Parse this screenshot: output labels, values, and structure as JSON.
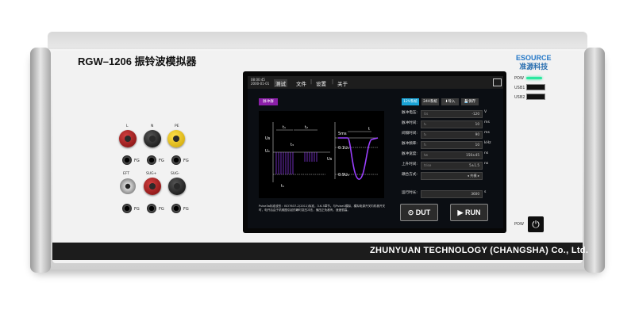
{
  "device": {
    "model_title": "RGW–1206  振铃波模拟器",
    "brand_name": "ESOURCE",
    "brand_cn": "准源科技",
    "footer": "ZHUNYUAN TECHNOLOGY (CHANGSHA) Co., Ltd.",
    "indicators": {
      "pow": "POW",
      "usb1": "USB1",
      "usb2": "USB2"
    },
    "power_button_label": "POW",
    "power_led_color": "#2be8a0"
  },
  "terminals": {
    "top_labels": [
      "L",
      "N",
      "PE"
    ],
    "bottom_labels": [
      "EFT",
      "SUG+",
      "SUG-"
    ],
    "fg": "FG"
  },
  "screen": {
    "clock_time": "08:00:45",
    "clock_date": "2000-01-01",
    "tabs": [
      "测试",
      "文件",
      "设置",
      "关于"
    ],
    "active_tab": "测试",
    "pulse_button": "脉冲群",
    "mode_buttons": [
      "12V系统",
      "24V系统",
      "⬇导入",
      "💾保存"
    ],
    "mode_active_color": "#1aa3d6",
    "params": [
      {
        "label": "脉冲电压:",
        "ph": "Us",
        "value": "-120",
        "unit": "V"
      },
      {
        "label": "脉冲时间:",
        "ph": "t₁",
        "value": "10",
        "unit": "ms"
      },
      {
        "label": "间隔时间:",
        "ph": "t₂",
        "value": "90",
        "unit": "ms"
      },
      {
        "label": "脉冲频率:",
        "ph": "f₁",
        "value": "10",
        "unit": "kHz"
      },
      {
        "label": "脉冲宽度:",
        "ph": "tw",
        "value": "150±45",
        "unit": "ns"
      },
      {
        "label": "上升时间:",
        "ph": "trise",
        "value": "5±1.5",
        "unit": "ns"
      },
      {
        "label": "耦合方式:",
        "ph": "",
        "value": "◂ 共模 ▸",
        "unit": ""
      },
      {
        "label": "运行时长:",
        "ph": "",
        "value": "3600",
        "unit": "s"
      }
    ],
    "description": "Pulse3a标准波形：ISO7637-2(2011)标准，3.6.3章节。与Pulse1模拟，模拟电源开关内机械开关时，电开后由于机械图引起的瞬时变压冲击，偏压正负都有，速度很高。",
    "waveform": {
      "labels": {
        "us": "Us",
        "u0": "U₀",
        "t1": "t₁",
        "t2": "t₂",
        "ts": "t₃",
        "t1b": "t₁",
        "tlong": "5ms",
        "u01": "0.1U₀",
        "u09": "0.9U₀",
        "tw": "t"
      }
    },
    "actions": {
      "dut": "DUT",
      "run": "RUN"
    }
  }
}
